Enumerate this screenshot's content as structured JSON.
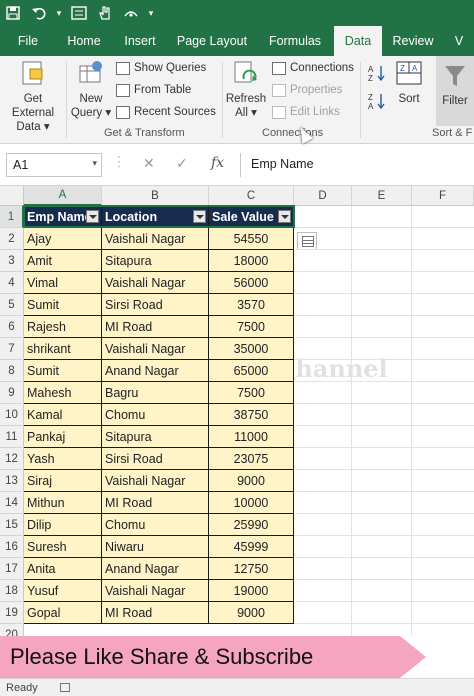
{
  "colors": {
    "excel_green": "#217346",
    "table_header": "#162d50",
    "table_row": "#fff3c8",
    "banner": "#f6a5c0"
  },
  "qat": {
    "icons": [
      "save-icon",
      "undo-icon",
      "dropdown-arrow-icon",
      "form-icon",
      "touch-mode-icon",
      "more-icon"
    ]
  },
  "tabs": [
    "File",
    "Home",
    "Insert",
    "Page Layout",
    "Formulas",
    "Data",
    "Review",
    "V"
  ],
  "active_tab": "Data",
  "ribbon": {
    "get_external": [
      "Get External",
      "Data ▾"
    ],
    "new_query": [
      "New",
      "Query ▾"
    ],
    "show_queries": "Show Queries",
    "from_table": "From Table",
    "recent_sources": "Recent Sources",
    "get_transform": "Get & Transform",
    "refresh_all": [
      "Refresh",
      "All ▾"
    ],
    "connections": "Connections",
    "properties": "Properties",
    "edit_links": "Edit Links",
    "connections_group": "Connections",
    "sort": "Sort",
    "filter": "Filter",
    "sort_filter_group": "Sort & F"
  },
  "formula_bar": {
    "name_box": "A1",
    "fx": "fx",
    "content": "Emp Name"
  },
  "columns": [
    "A",
    "B",
    "C",
    "D",
    "E",
    "F"
  ],
  "table": {
    "headers": [
      "Emp Name",
      "Location",
      "Sale Value"
    ],
    "rows": [
      [
        "Ajay",
        "Vaishali Nagar",
        "54550"
      ],
      [
        "Amit",
        "Sitapura",
        "18000"
      ],
      [
        "Vimal",
        "Vaishali Nagar",
        "56000"
      ],
      [
        "Sumit",
        "Sirsi Road",
        "3570"
      ],
      [
        "Rajesh",
        "MI Road",
        "7500"
      ],
      [
        "shrikant",
        "Vaishali Nagar",
        "35000"
      ],
      [
        "Sumit",
        "Anand Nagar",
        "65000"
      ],
      [
        "Mahesh",
        "Bagru",
        "7500"
      ],
      [
        "Kamal",
        "Chomu",
        "38750"
      ],
      [
        "Pankaj",
        "Sitapura",
        "11000"
      ],
      [
        "Yash",
        "Sirsi Road",
        "23075"
      ],
      [
        "Siraj",
        "Vaishali Nagar",
        "9000"
      ],
      [
        "Mithun",
        "MI Road",
        "10000"
      ],
      [
        "Dilip",
        "Chomu",
        "25990"
      ],
      [
        "Suresh",
        "Niwaru",
        "45999"
      ],
      [
        "Anita",
        "Anand Nagar",
        "12750"
      ],
      [
        "Yusuf",
        "Vaishali Nagar",
        "19000"
      ],
      [
        "Gopal",
        "MI Road",
        "9000"
      ]
    ]
  },
  "watermark": "celltoe Youtube Channel",
  "banner": "Please Like Share & Subscribe",
  "status": "Ready"
}
